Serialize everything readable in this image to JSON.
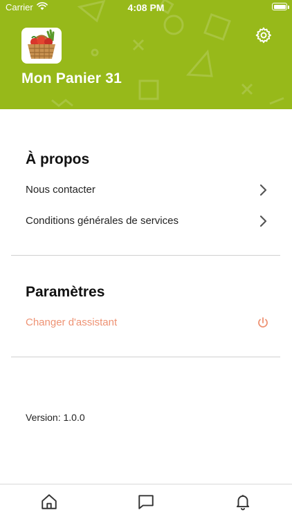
{
  "status_bar": {
    "carrier": "Carrier",
    "time": "4:08 PM"
  },
  "header": {
    "app_name": "Mon Panier 31",
    "background_color": "#97b91a"
  },
  "about": {
    "title": "À propos",
    "items": [
      {
        "label": "Nous contacter",
        "icon": "chevron-right-icon"
      },
      {
        "label": "Conditions générales de services",
        "icon": "chevron-right-icon"
      }
    ]
  },
  "settings": {
    "title": "Paramètres",
    "items": [
      {
        "label": "Changer d'assistant",
        "icon": "power-icon",
        "color": "#ee9273"
      }
    ]
  },
  "version": "Version: 1.0.0",
  "tab_bar": {
    "tabs": [
      {
        "icon": "home-icon"
      },
      {
        "icon": "chat-icon"
      },
      {
        "icon": "bell-icon"
      }
    ]
  }
}
